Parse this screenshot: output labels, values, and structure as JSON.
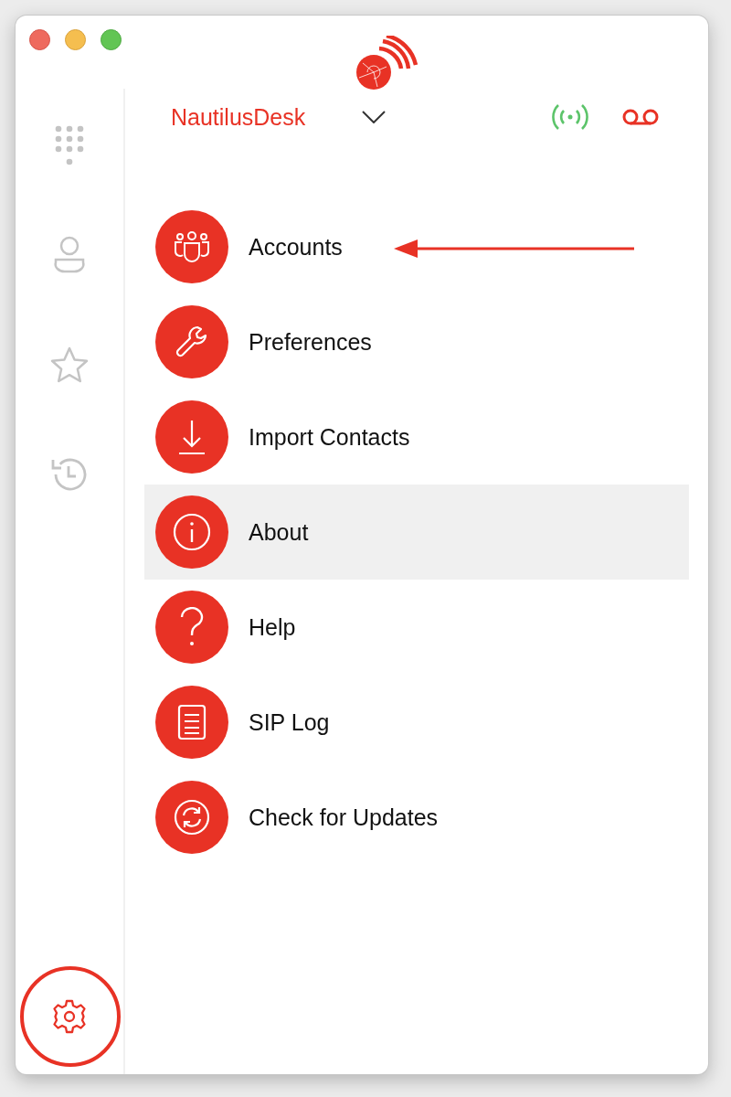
{
  "sidebar": {
    "items": [
      {
        "kind": "dialpad",
        "selected": false
      },
      {
        "kind": "contacts",
        "selected": false
      },
      {
        "kind": "favorites",
        "selected": false
      },
      {
        "kind": "history",
        "selected": false
      },
      {
        "kind": "settings",
        "selected": true
      }
    ]
  },
  "account": {
    "name": "NautilusDesk"
  },
  "menu": [
    {
      "kind": "accounts",
      "label": "Accounts",
      "selected": false
    },
    {
      "kind": "preferences",
      "label": "Preferences",
      "selected": false
    },
    {
      "kind": "import",
      "label": "Import Contacts",
      "selected": false
    },
    {
      "kind": "about",
      "label": "About",
      "selected": true
    },
    {
      "kind": "help",
      "label": "Help",
      "selected": false
    },
    {
      "kind": "log",
      "label": "SIP Log",
      "selected": false
    },
    {
      "kind": "updates",
      "label": "Check for Updates",
      "selected": false
    }
  ]
}
